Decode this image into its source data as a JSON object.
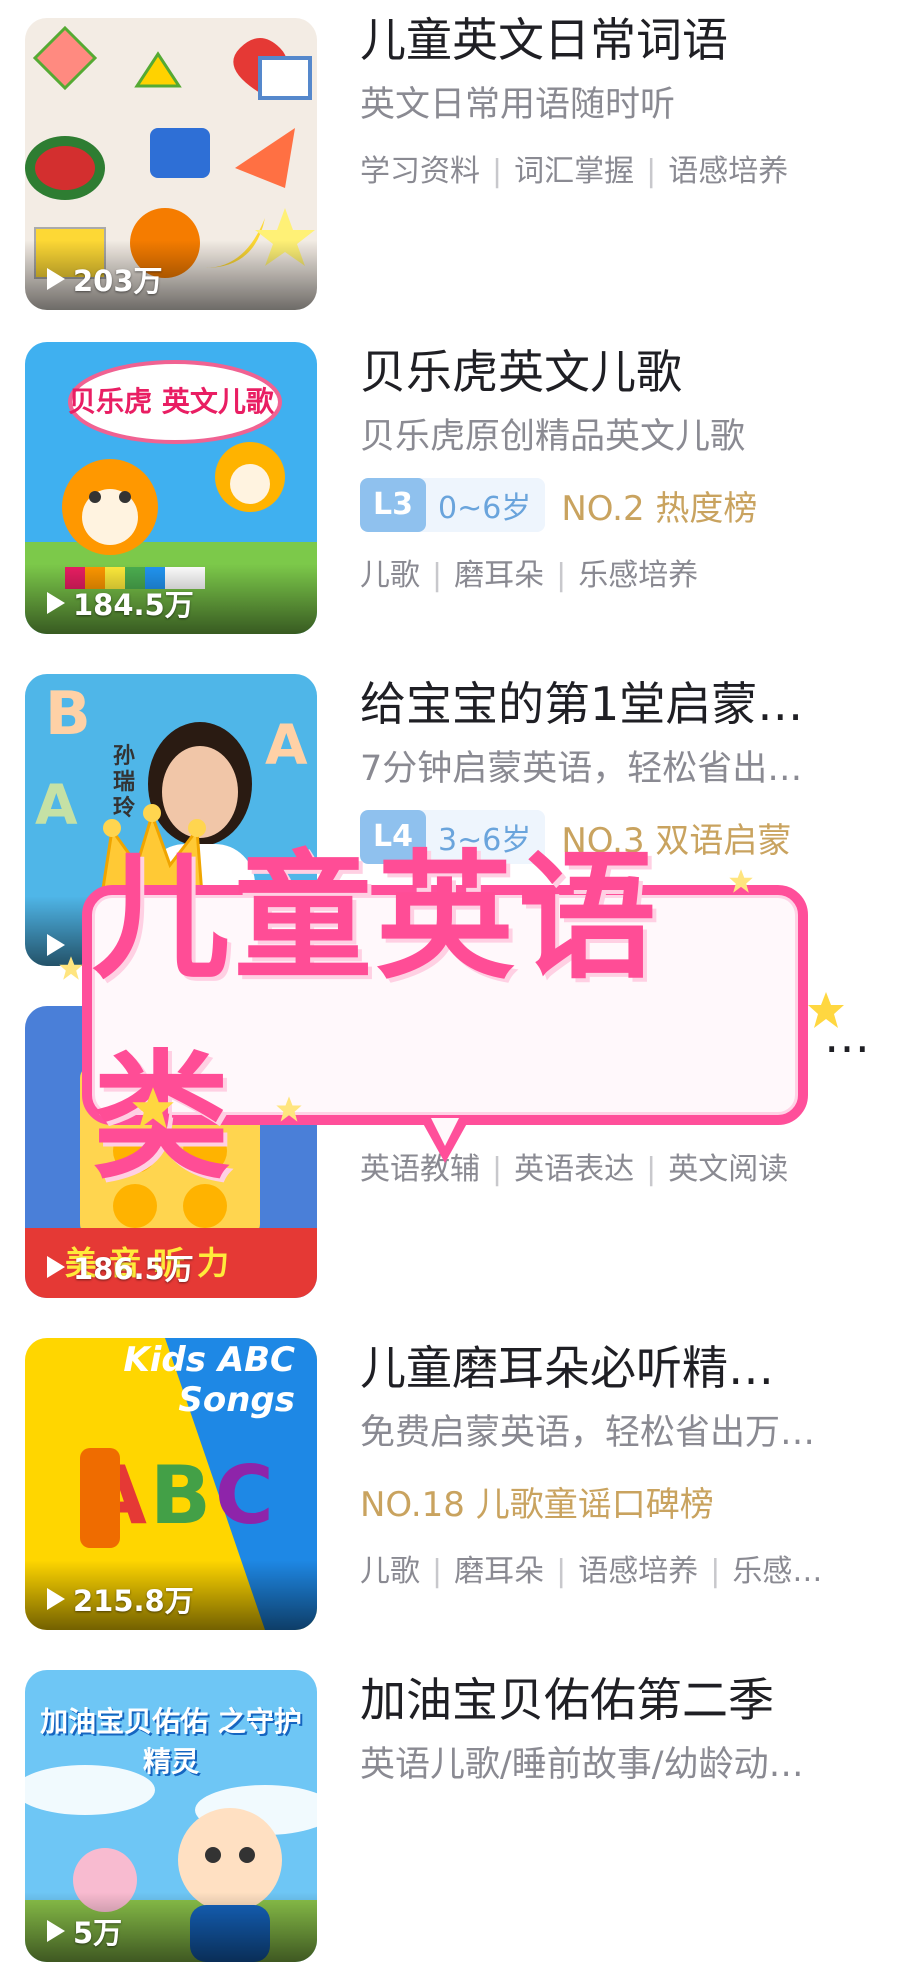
{
  "items": [
    {
      "title": "儿童英文日常词语",
      "subtitle": "英文日常用语随时听",
      "plays": "203万",
      "tags": [
        "学习资料",
        "词汇掌握",
        "语感培养"
      ]
    },
    {
      "title": "贝乐虎英文儿歌",
      "subtitle": "贝乐虎原创精品英文儿歌",
      "plays": "184.5万",
      "level": "L3",
      "age": "0~6岁",
      "rank": "NO.2 热度榜",
      "tags": [
        "儿歌",
        "磨耳朵",
        "乐感培养"
      ],
      "thumb_text": "贝乐虎 英文儿歌"
    },
    {
      "title": "给宝宝的第1堂启蒙…",
      "subtitle": "7分钟启蒙英语，轻松省出…",
      "plays": "",
      "level": "L4",
      "age": "3~6岁",
      "rank": "NO.3 双语启蒙",
      "thumb_text": "孙瑞玲"
    },
    {
      "title": "…",
      "plays": "186.5万",
      "tags": [
        "英语教辅",
        "英语表达",
        "英文阅读"
      ],
      "thumb_text": "美音听力"
    },
    {
      "title": "儿童磨耳朵必听精…",
      "subtitle": "免费启蒙英语，轻松省出万…",
      "plays": "215.8万",
      "rank": "NO.18 儿歌童谣口碑榜",
      "tags": [
        "儿歌",
        "磨耳朵",
        "语感培养",
        "乐感…"
      ],
      "thumb_text": "Kids ABC Songs"
    },
    {
      "title": "加油宝贝佑佑第二季",
      "subtitle": "英语儿歌/睡前故事/幼龄动…",
      "plays": "5万",
      "thumb_text": "加油宝贝佑佑 之守护精灵"
    }
  ],
  "banner": {
    "text": "儿童英语类"
  },
  "colors": {
    "accent_pink": "#ff4d96",
    "rank_gold": "#c9a35f",
    "level_blue": "#8fc1ee"
  }
}
